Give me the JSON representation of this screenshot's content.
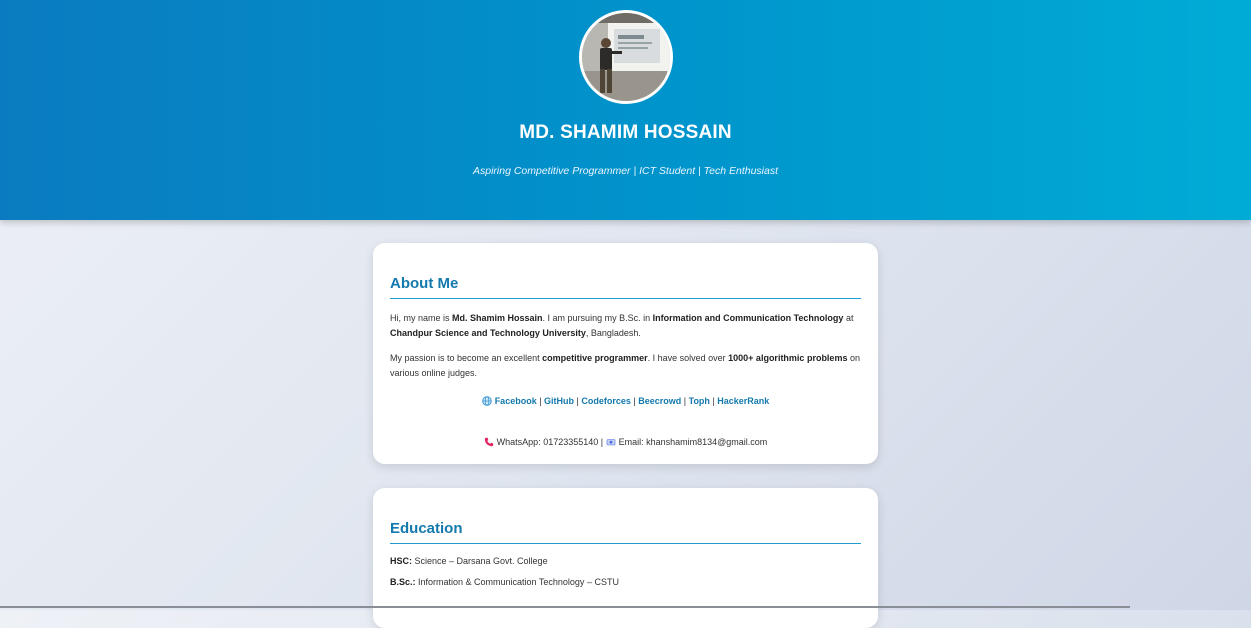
{
  "header": {
    "name": "MD. SHAMIM HOSSAIN",
    "tagline": "Aspiring Competitive Programmer | ICT Student | Tech Enthusiast"
  },
  "about": {
    "heading": "About Me",
    "p1_a": "Hi, my name is ",
    "p1_name": "Md. Shamim Hossain",
    "p1_b": ". I am pursuing my B.Sc. in ",
    "p1_subject": "Information and Communication Technology",
    "p1_c": " at ",
    "p1_uni": "Chandpur Science and Technology University",
    "p1_d": ", Bangladesh.",
    "p2_a": "My passion is to become an excellent ",
    "p2_b": "competitive programmer",
    "p2_c": ". I have solved over ",
    "p2_d": "1000+ algorithmic problems",
    "p2_e": " on various online judges.",
    "links": [
      "Facebook",
      "GitHub",
      "Codeforces",
      "Beecrowd",
      "Toph",
      "HackerRank"
    ],
    "separator": " | ",
    "contact_whatsapp": "WhatsApp: 01723355140",
    "contact_sep": " | ",
    "contact_email": "Email: khanshamim8134@gmail.com",
    "icons": {
      "links": "globe-icon",
      "phone": "phone-icon",
      "email": "email-icon"
    }
  },
  "education": {
    "heading": "Education",
    "items": [
      {
        "label": "HSC:",
        "value": " Science – Darsana Govt. College"
      },
      {
        "label": "B.Sc.:",
        "value": " Information & Communication Technology – CSTU"
      }
    ]
  }
}
